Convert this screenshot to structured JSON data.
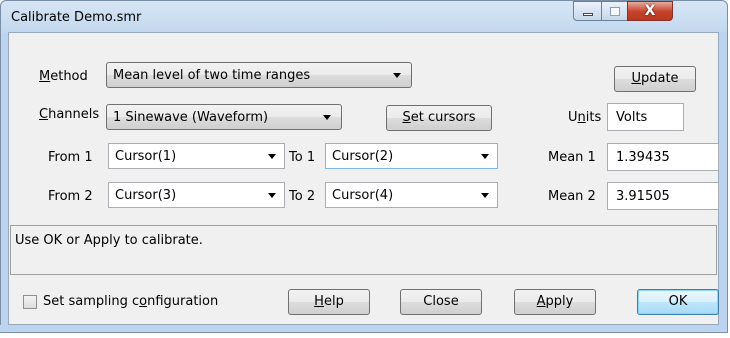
{
  "window": {
    "title": "Calibrate Demo.smr",
    "close_glyph": "X"
  },
  "method": {
    "label_pre": "",
    "label_mnemonic": "M",
    "label_post": "ethod",
    "value": "Mean level of two time ranges"
  },
  "channels": {
    "label_mnemonic": "C",
    "label_post": "hannels",
    "value": "1 Sinewave (Waveform)"
  },
  "set_cursors": {
    "mnemonic": "S",
    "rest": "et cursors"
  },
  "update": {
    "mnemonic": "U",
    "rest": "pdate"
  },
  "units": {
    "label_pre": "U",
    "label_mnemonic": "n",
    "label_post": "its",
    "value": "Volts"
  },
  "range1": {
    "from_label": "From 1",
    "from_value": "Cursor(1)",
    "to_label": "To 1",
    "to_value": "Cursor(2)",
    "mean_label": "Mean 1",
    "mean_value": "1.39435"
  },
  "range2": {
    "from_label": "From 2",
    "from_value": "Cursor(3)",
    "to_label": "To 2",
    "to_value": "Cursor(4)",
    "mean_label": "Mean 2",
    "mean_value": "3.91505"
  },
  "status_text": "Use OK or Apply to calibrate.",
  "sampling": {
    "label_pre": "Set sampling c",
    "label_mnemonic": "o",
    "label_post": "nfiguration",
    "checked": false
  },
  "buttons": {
    "help_mnemonic": "H",
    "help_rest": "elp",
    "close": "Close",
    "apply_mnemonic": "A",
    "apply_rest": "pply",
    "ok": "OK"
  },
  "colors": {
    "frame": "#bcd4ee",
    "client": "#f0f0f0",
    "close_button": "#c4412a"
  }
}
